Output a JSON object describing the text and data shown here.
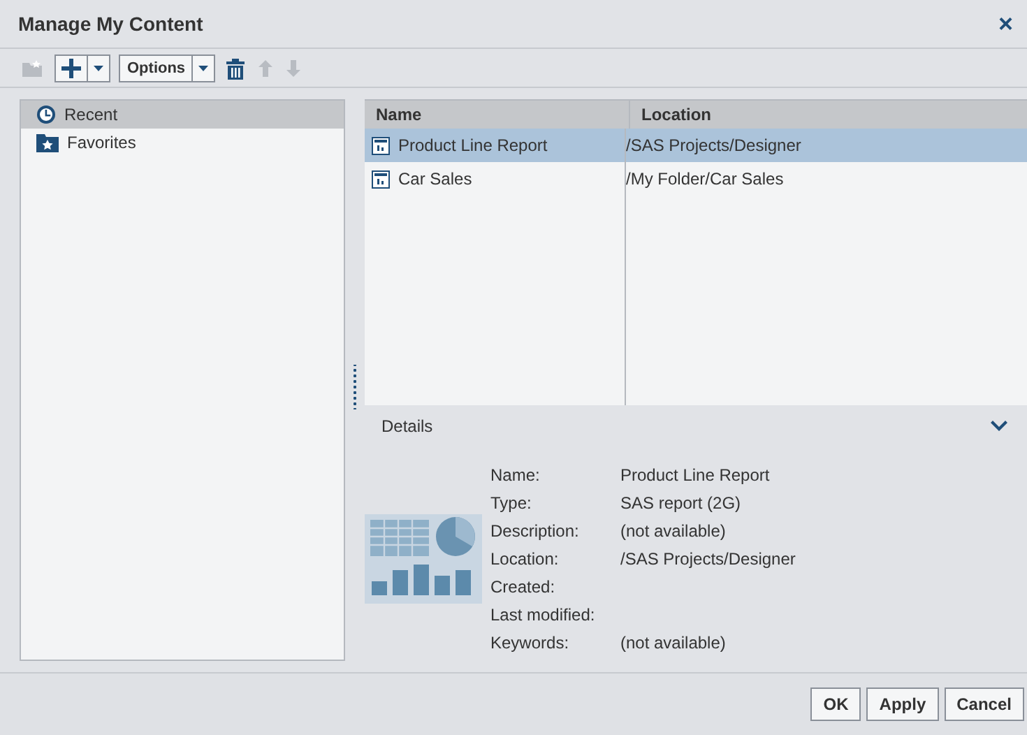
{
  "window": {
    "title": "Manage My Content",
    "close": "×"
  },
  "toolbar": [
    {
      "kind": "newfolder",
      "disabled": true
    },
    {
      "kind": "add",
      "disabled": false
    },
    {
      "kind": "options",
      "label": "Options",
      "disabled": false
    },
    {
      "kind": "delete",
      "disabled": false
    },
    {
      "kind": "up",
      "disabled": true
    },
    {
      "kind": "down",
      "disabled": true
    }
  ],
  "sidebar": {
    "items": [
      {
        "kind": "recent",
        "label": "Recent",
        "selected": true
      },
      {
        "kind": "favorites",
        "label": "Favorites",
        "selected": false
      }
    ]
  },
  "table": {
    "columns": [
      "Name",
      "Location"
    ],
    "rows": [
      {
        "name": "Product Line Report",
        "location": "/SAS Projects/Designer",
        "selected": true
      },
      {
        "name": "Car Sales",
        "location": "/My Folder/Car Sales",
        "selected": false
      }
    ]
  },
  "details": {
    "title": "Details",
    "expanded": true,
    "fields": [
      {
        "label": "Name:",
        "value": "Product Line Report"
      },
      {
        "label": "Type:",
        "value": "SAS report (2G)"
      },
      {
        "label": "Description:",
        "value": "(not available)"
      },
      {
        "label": "Location:",
        "value": "/SAS Projects/Designer"
      },
      {
        "label": "Created:"
      },
      {
        "label": "Last modified:"
      },
      {
        "label": "Keywords:",
        "value": "(not available)"
      }
    ]
  },
  "buttons": [
    "OK",
    "Apply",
    "Cancel"
  ]
}
